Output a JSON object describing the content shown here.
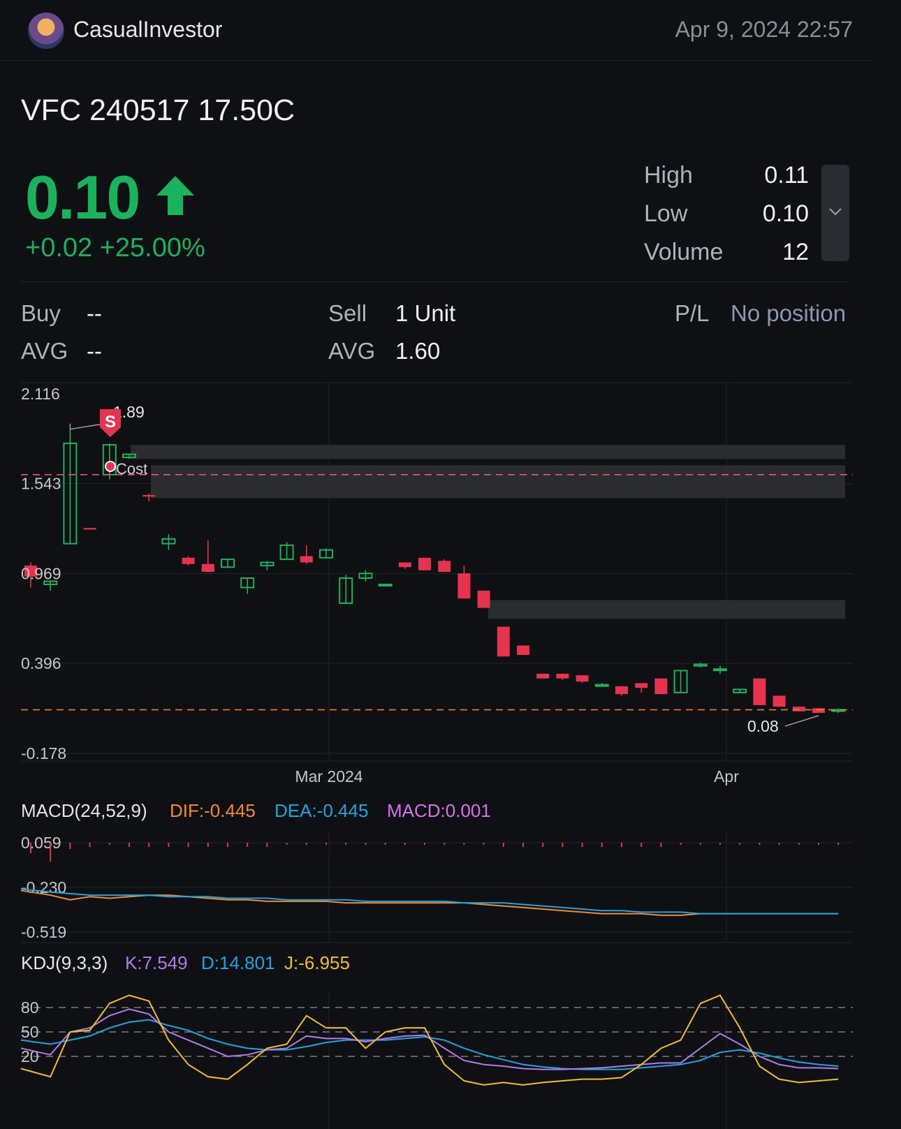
{
  "header": {
    "username": "CasualInvestor",
    "timestamp": "Apr 9, 2024 22:57"
  },
  "quote": {
    "symbol": "VFC 240517 17.50C",
    "price": "0.10",
    "change": "+0.02 +25.00%",
    "high_label": "High",
    "high": "0.11",
    "low_label": "Low",
    "low": "0.10",
    "volume_label": "Volume",
    "volume": "12"
  },
  "position": {
    "buy_label": "Buy",
    "buy": "--",
    "buy_avg_label": "AVG",
    "buy_avg": "--",
    "sell_label": "Sell",
    "sell": "1 Unit",
    "sell_avg_label": "AVG",
    "sell_avg": "1.60",
    "pl_label": "P/L",
    "pl": "No position"
  },
  "colors": {
    "up": "#19b35e",
    "down": "#e8334f",
    "cost_line": "#e8557a",
    "last_line": "#e8832a",
    "dif": "#f28a2e",
    "dea": "#1aa6e0",
    "macd": "#d872e8",
    "k": "#b07ae8",
    "d": "#1aa6e0",
    "j": "#f2c01e"
  },
  "chart_data": [
    {
      "type": "candlestick",
      "y_ticks": [
        "2.116",
        "1.543",
        "0.969",
        "0.396",
        "-0.178"
      ],
      "ylim": [
        -0.178,
        2.116
      ],
      "x_ticks": [
        "Mar 2024",
        "Apr"
      ],
      "markers": {
        "sell_marker": "S",
        "sell_price_label": "1.89",
        "cost_label": "Cost",
        "low_label": "0.08"
      },
      "reference_lines": {
        "cost": 1.6,
        "last": 0.1
      },
      "candles": [
        {
          "o": 1.02,
          "h": 1.04,
          "l": 0.88,
          "c": 0.95
        },
        {
          "o": 0.9,
          "h": 0.92,
          "l": 0.86,
          "c": 0.92
        },
        {
          "o": 1.16,
          "h": 1.89,
          "l": 1.16,
          "c": 1.8
        },
        {
          "o": 1.26,
          "h": 1.26,
          "l": 1.26,
          "c": 1.25
        },
        {
          "o": 1.6,
          "h": 1.8,
          "l": 1.57,
          "c": 1.79
        },
        {
          "o": 1.71,
          "h": 1.73,
          "l": 1.7,
          "c": 1.73
        },
        {
          "o": 1.47,
          "h": 1.48,
          "l": 1.43,
          "c": 1.46
        },
        {
          "o": 1.16,
          "h": 1.22,
          "l": 1.12,
          "c": 1.19
        },
        {
          "o": 1.07,
          "h": 1.08,
          "l": 1.02,
          "c": 1.03
        },
        {
          "o": 1.03,
          "h": 1.18,
          "l": 0.98,
          "c": 0.98
        },
        {
          "o": 1.01,
          "h": 1.06,
          "l": 1.01,
          "c": 1.06
        },
        {
          "o": 0.88,
          "h": 0.94,
          "l": 0.84,
          "c": 0.94
        },
        {
          "o": 1.02,
          "h": 1.05,
          "l": 0.99,
          "c": 1.04
        },
        {
          "o": 1.06,
          "h": 1.17,
          "l": 1.06,
          "c": 1.15
        },
        {
          "o": 1.08,
          "h": 1.15,
          "l": 1.03,
          "c": 1.04
        },
        {
          "o": 1.07,
          "h": 1.13,
          "l": 1.07,
          "c": 1.12
        },
        {
          "o": 0.78,
          "h": 0.96,
          "l": 0.78,
          "c": 0.94
        },
        {
          "o": 0.94,
          "h": 0.99,
          "l": 0.92,
          "c": 0.97
        },
        {
          "o": 0.9,
          "h": 0.9,
          "l": 0.9,
          "c": 0.9
        },
        {
          "o": 1.04,
          "h": 1.04,
          "l": 1.0,
          "c": 1.01
        },
        {
          "o": 1.07,
          "h": 1.07,
          "l": 0.99,
          "c": 0.99
        },
        {
          "o": 1.05,
          "h": 1.06,
          "l": 0.98,
          "c": 0.98
        },
        {
          "o": 0.97,
          "h": 1.02,
          "l": 0.81,
          "c": 0.81
        },
        {
          "o": 0.86,
          "h": 0.86,
          "l": 0.75,
          "c": 0.75
        },
        {
          "o": 0.63,
          "h": 0.63,
          "l": 0.44,
          "c": 0.44
        },
        {
          "o": 0.51,
          "h": 0.51,
          "l": 0.45,
          "c": 0.45
        },
        {
          "o": 0.33,
          "h": 0.33,
          "l": 0.3,
          "c": 0.3
        },
        {
          "o": 0.33,
          "h": 0.33,
          "l": 0.29,
          "c": 0.3
        },
        {
          "o": 0.32,
          "h": 0.32,
          "l": 0.27,
          "c": 0.28
        },
        {
          "o": 0.26,
          "h": 0.27,
          "l": 0.25,
          "c": 0.26
        },
        {
          "o": 0.25,
          "h": 0.25,
          "l": 0.19,
          "c": 0.2
        },
        {
          "o": 0.27,
          "h": 0.27,
          "l": 0.21,
          "c": 0.24
        },
        {
          "o": 0.3,
          "h": 0.3,
          "l": 0.2,
          "c": 0.2
        },
        {
          "o": 0.21,
          "h": 0.35,
          "l": 0.21,
          "c": 0.35
        },
        {
          "o": 0.38,
          "h": 0.4,
          "l": 0.37,
          "c": 0.39
        },
        {
          "o": 0.36,
          "h": 0.38,
          "l": 0.33,
          "c": 0.36
        },
        {
          "o": 0.21,
          "h": 0.23,
          "l": 0.21,
          "c": 0.23
        },
        {
          "o": 0.3,
          "h": 0.3,
          "l": 0.13,
          "c": 0.13
        },
        {
          "o": 0.19,
          "h": 0.19,
          "l": 0.12,
          "c": 0.12
        },
        {
          "o": 0.12,
          "h": 0.12,
          "l": 0.09,
          "c": 0.09
        },
        {
          "o": 0.11,
          "h": 0.11,
          "l": 0.08,
          "c": 0.08
        },
        {
          "o": 0.1,
          "h": 0.11,
          "l": 0.08,
          "c": 0.1
        }
      ]
    },
    {
      "type": "line",
      "title": "MACD(24,52,9)",
      "labels": {
        "dif": "DIF:-0.445",
        "dea": "DEA:-0.445",
        "macd": "MACD:0.001"
      },
      "y_ticks": [
        "0.059",
        "-0.230",
        "-0.519"
      ],
      "ylim": [
        -0.519,
        0.059
      ],
      "dif": [
        -0.25,
        -0.28,
        -0.31,
        -0.29,
        -0.3,
        -0.29,
        -0.28,
        -0.28,
        -0.29,
        -0.3,
        -0.31,
        -0.31,
        -0.32,
        -0.32,
        -0.32,
        -0.32,
        -0.33,
        -0.33,
        -0.33,
        -0.33,
        -0.33,
        -0.33,
        -0.33,
        -0.34,
        -0.35,
        -0.36,
        -0.37,
        -0.38,
        -0.39,
        -0.4,
        -0.4,
        -0.4,
        -0.41,
        -0.41,
        -0.4,
        -0.4,
        -0.4,
        -0.4,
        -0.4,
        -0.4,
        -0.4,
        -0.4
      ],
      "dea": [
        -0.24,
        -0.26,
        -0.27,
        -0.28,
        -0.28,
        -0.28,
        -0.28,
        -0.29,
        -0.29,
        -0.29,
        -0.3,
        -0.3,
        -0.3,
        -0.31,
        -0.31,
        -0.31,
        -0.31,
        -0.32,
        -0.32,
        -0.32,
        -0.32,
        -0.32,
        -0.33,
        -0.33,
        -0.33,
        -0.34,
        -0.35,
        -0.36,
        -0.37,
        -0.38,
        -0.38,
        -0.39,
        -0.39,
        -0.39,
        -0.4,
        -0.4,
        -0.4,
        -0.4,
        -0.4,
        -0.4,
        -0.4,
        -0.4
      ],
      "macd": [
        -0.05,
        -0.09,
        -0.03,
        -0.02,
        -0.01,
        -0.02,
        -0.02,
        -0.02,
        -0.02,
        -0.02,
        -0.02,
        -0.02,
        -0.02,
        -0.01,
        -0.01,
        -0.01,
        -0.01,
        -0.01,
        -0.01,
        -0.01,
        -0.01,
        -0.01,
        -0.01,
        -0.01,
        -0.02,
        -0.02,
        -0.02,
        -0.02,
        -0.02,
        -0.02,
        -0.02,
        -0.02,
        -0.02,
        -0.01,
        -0.01,
        -0.005,
        -0.003,
        -0.002,
        -0.002,
        -0.001,
        -0.001,
        0.001
      ]
    },
    {
      "type": "line",
      "title": "KDJ(9,3,3)",
      "labels": {
        "k": "K:7.549",
        "d": "D:14.801",
        "j": "J:-6.955"
      },
      "y_ticks": [
        "80",
        "50",
        "20"
      ],
      "ylim": [
        -15,
        115
      ],
      "k": [
        30,
        22,
        50,
        55,
        70,
        78,
        72,
        50,
        40,
        30,
        20,
        22,
        28,
        30,
        45,
        42,
        42,
        38,
        42,
        45,
        46,
        30,
        15,
        10,
        8,
        5,
        4,
        4,
        5,
        6,
        8,
        10,
        12,
        12,
        30,
        48,
        35,
        20,
        10,
        6,
        6,
        5
      ],
      "d": [
        40,
        35,
        40,
        45,
        55,
        62,
        65,
        58,
        52,
        42,
        35,
        30,
        28,
        28,
        32,
        37,
        40,
        40,
        40,
        42,
        44,
        40,
        30,
        22,
        16,
        10,
        7,
        5,
        4,
        4,
        4,
        6,
        8,
        10,
        15,
        25,
        28,
        24,
        18,
        13,
        10,
        8
      ],
      "j": [
        5,
        -5,
        50,
        52,
        85,
        95,
        88,
        40,
        10,
        -5,
        -8,
        10,
        30,
        35,
        70,
        55,
        55,
        30,
        50,
        55,
        55,
        10,
        -10,
        -15,
        -12,
        -15,
        -12,
        -10,
        -8,
        -8,
        -6,
        10,
        30,
        40,
        85,
        95,
        55,
        8,
        -8,
        -12,
        -10,
        -8
      ]
    }
  ]
}
